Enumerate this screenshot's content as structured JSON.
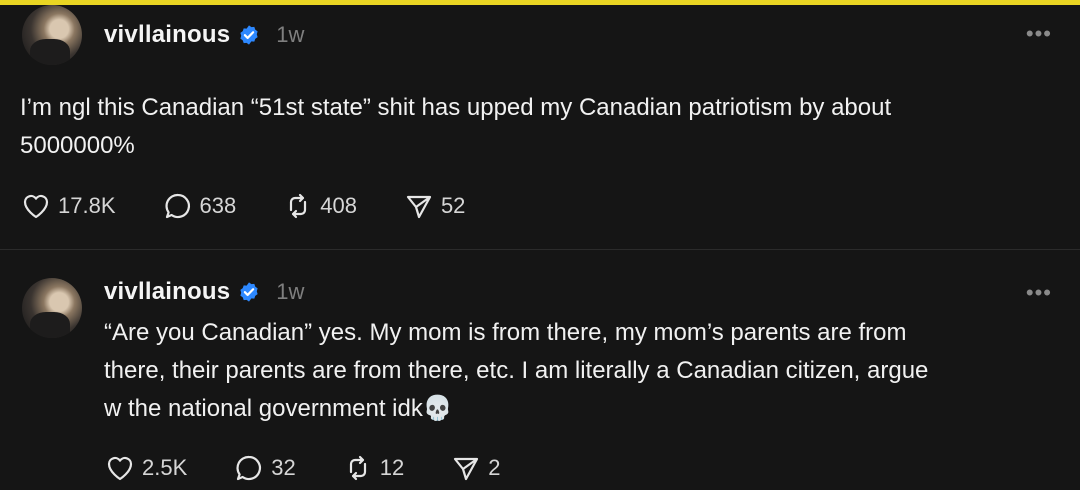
{
  "posts": [
    {
      "username": "vivllainous",
      "time": "1w",
      "text_lines": [
        "I’m ngl this Canadian “51st state” shit has upped my Canadian patriotism by about",
        "5000000%"
      ],
      "likes": "17.8K",
      "comments": "638",
      "reposts": "408",
      "shares": "52"
    },
    {
      "username": "vivllainous",
      "time": "1w",
      "text_lines": [
        "“Are you Canadian” yes. My mom is from there, my mom’s parents are from",
        "there, their parents are from there, etc. I am literally a Canadian citizen, argue",
        "w the national government idk💀"
      ],
      "likes": "2.5K",
      "comments": "32",
      "reposts": "12",
      "shares": "2"
    }
  ],
  "colors": {
    "accent_bar": "#e9d523",
    "verified": "#2d88ff",
    "background": "#151515"
  },
  "icons": [
    "verified-badge-icon",
    "heart-icon",
    "comment-icon",
    "repost-icon",
    "share-icon",
    "more-options-icon"
  ]
}
